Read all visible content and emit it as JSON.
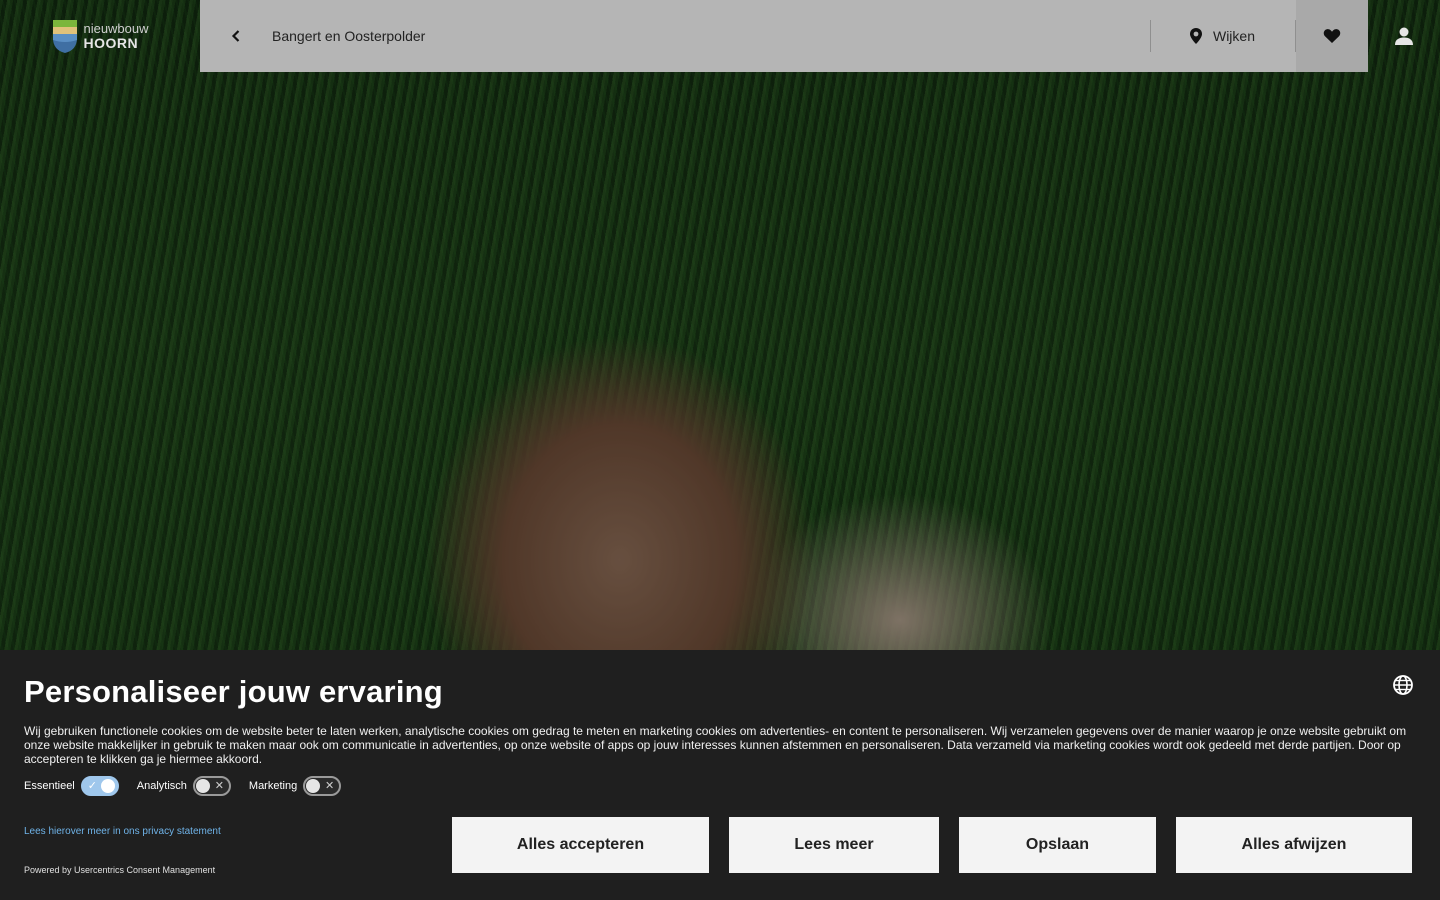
{
  "header": {
    "logo": {
      "line1": "nieuwbouw",
      "line2": "HOORN"
    },
    "title": "Bangert en Oosterpolder",
    "wijken_label": "Wijken",
    "icons": {
      "back": "chevron-left-icon",
      "wijken": "map-pin-icon",
      "favorites": "heart-icon",
      "account": "user-icon"
    }
  },
  "cookie": {
    "title": "Personaliseer jouw ervaring",
    "text": "Wij gebruiken functionele cookies om de website beter te laten werken, analytische cookies om gedrag te meten en marketing cookies om advertenties- en content te personaliseren. Wij verzamelen gegevens over de manier waarop je onze website gebruikt om onze website makkelijker in gebruik te maken maar ook om communicatie in advertenties, op onze website of apps op jouw interesses kunnen afstemmen en personaliseren. Data verzameld via marketing cookies wordt ook gedeeld met derde partijen. Door op accepteren te klikken ga je hiermee akkoord.",
    "toggles": [
      {
        "label": "Essentieel",
        "on": true
      },
      {
        "label": "Analytisch",
        "on": false
      },
      {
        "label": "Marketing",
        "on": false
      }
    ],
    "privacy_link": "Lees hierover meer in ons privacy statement",
    "powered_by": "Powered by Usercentrics Consent Management",
    "buttons": {
      "accept_all": "Alles accepteren",
      "read_more": "Lees meer",
      "save": "Opslaan",
      "deny_all": "Alles afwijzen"
    }
  },
  "colors": {
    "navbar": "#b5b5b5",
    "banner": "#1f1f1f",
    "toggle_on": "#9fc7ec",
    "link": "#6fb3e8"
  }
}
